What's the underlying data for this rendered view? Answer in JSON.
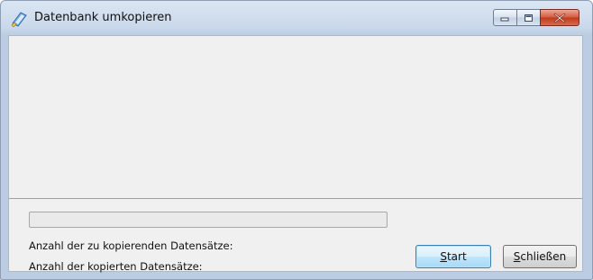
{
  "window": {
    "title": "Datenbank umkopieren"
  },
  "icons": {
    "app": "database-copy-icon",
    "minimize": "minimize-icon",
    "maximize": "maximize-icon",
    "close": "close-icon"
  },
  "status": {
    "records_to_copy_label": "Anzahl der zu kopierenden Datensätze:",
    "records_copied_label": "Anzahl der kopierten Datensätze:"
  },
  "progress": {
    "value": 0
  },
  "buttons": {
    "start_accesskey": "S",
    "start_rest": "tart",
    "close_accesskey": "S",
    "close_rest": "chließen"
  },
  "colors": {
    "title_bar": "#c9d8ea",
    "client_bg": "#f0f0f0",
    "close_button": "#c0391b",
    "default_button_border": "#3c7fb1"
  }
}
